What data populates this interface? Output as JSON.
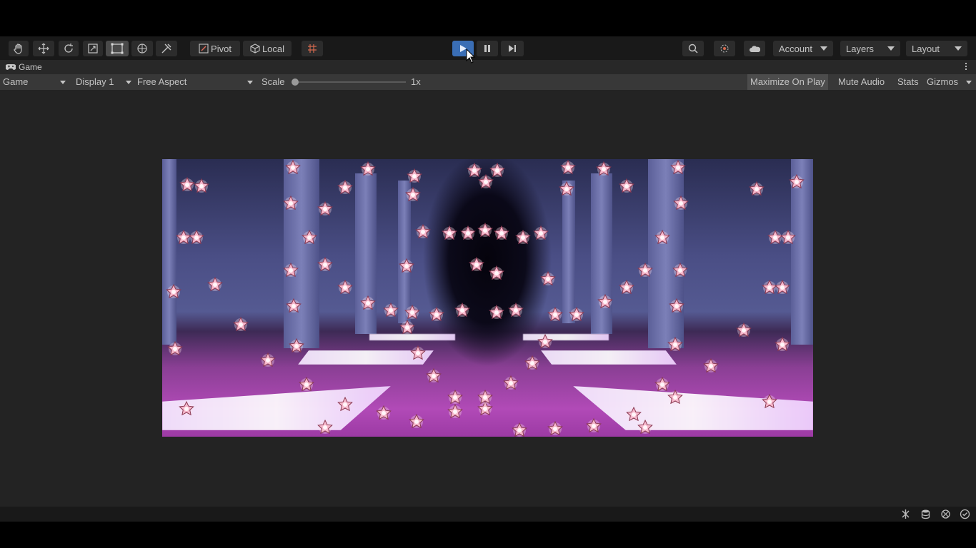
{
  "toolbar": {
    "tools": [
      "hand-tool",
      "move-tool",
      "rotate-tool",
      "scale-tool",
      "rect-tool",
      "transform-tool",
      "custom-tool"
    ],
    "pivot_label": "Pivot",
    "local_label": "Local",
    "account_label": "Account",
    "layers_label": "Layers",
    "layout_label": "Layout"
  },
  "tab": {
    "title": "Game"
  },
  "gamebar": {
    "view_mode": "Game",
    "display": "Display 1",
    "aspect": "Free Aspect",
    "scale_label": "Scale",
    "scale_value": "1x",
    "maximize_label": "Maximize On Play",
    "mute_label": "Mute Audio",
    "stats_label": "Stats",
    "gizmos_label": "Gizmos"
  },
  "playback": {
    "playing": true
  },
  "colors": {
    "accent": "#3a6eb5",
    "star": "#f6b8cc",
    "floor": "#b14ab7"
  }
}
